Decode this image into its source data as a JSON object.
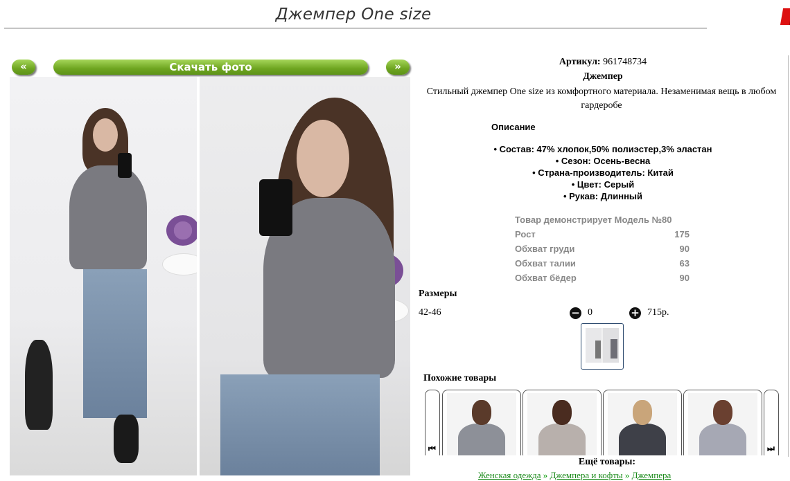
{
  "page": {
    "title": "Джемпер One size"
  },
  "gallery": {
    "prev_label": "«",
    "next_label": "»",
    "download_label": "Скачать фото"
  },
  "product": {
    "article_label": "Артикул:",
    "article_value": "961748734",
    "name": "Джемпер",
    "description": "Стильный джемпер One size из комфортного материала. Незаменимая вещь в любом гардеробе",
    "description_heading": "Описание",
    "features": [
      "• Состав: 47% хлопок,50% полиэстер,3% эластан",
      "• Сезон: Осень-весна",
      "• Страна-производитель: Китай",
      "• Цвет: Серый",
      "• Рукав: Длинный"
    ]
  },
  "model": {
    "rows": [
      {
        "label": "Товар демонстрирует Модель №80",
        "value": ""
      },
      {
        "label": "Рост",
        "value": "175"
      },
      {
        "label": "Обхват груди",
        "value": "90"
      },
      {
        "label": "Обхват талии",
        "value": "63"
      },
      {
        "label": "Обхват бёдер",
        "value": "90"
      }
    ]
  },
  "sizes": {
    "heading": "Размеры",
    "size": "42-46",
    "minus_icon": "minus-circle-icon",
    "plus_icon": "plus-circle-icon",
    "quantity": "0",
    "price": "715р."
  },
  "similar": {
    "heading": "Похожие товары",
    "items": [
      {
        "sweater_color": "#8d9098",
        "hair_color": "#5a3a2a"
      },
      {
        "sweater_color": "#b8b0ac",
        "hair_color": "#4a2c20"
      },
      {
        "sweater_color": "#3e4048",
        "hair_color": "#c9a57a"
      },
      {
        "sweater_color": "#a6a8b4",
        "hair_color": "#6a4030"
      }
    ]
  },
  "more": {
    "heading": "Ещё товары:",
    "links": [
      "Женская одежда",
      "Джемпера и кофты",
      "Джемпера"
    ],
    "separator": " » "
  }
}
